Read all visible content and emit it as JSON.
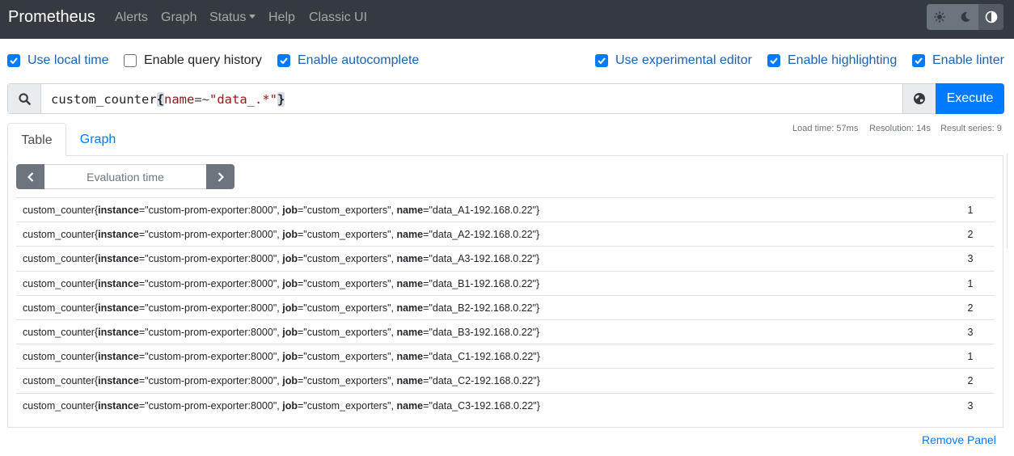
{
  "navbar": {
    "brand": "Prometheus",
    "links": [
      "Alerts",
      "Graph",
      "Status",
      "Help",
      "Classic UI"
    ],
    "theme_buttons": [
      "sun-icon",
      "moon-icon",
      "adjust-icon"
    ]
  },
  "options": {
    "use_local_time": {
      "label": "Use local time",
      "checked": true
    },
    "query_history": {
      "label": "Enable query history",
      "checked": false
    },
    "autocomplete": {
      "label": "Enable autocomplete",
      "checked": true
    },
    "experimental_editor": {
      "label": "Use experimental editor",
      "checked": true
    },
    "highlighting": {
      "label": "Enable highlighting",
      "checked": true
    },
    "linter": {
      "label": "Enable linter",
      "checked": true
    }
  },
  "query": {
    "metric": "custom_counter",
    "open_brace": "{",
    "label": "name",
    "operator": "=~",
    "value": "\"data_.*\"",
    "close_brace": "}",
    "execute_label": "Execute"
  },
  "tabs": {
    "table": "Table",
    "graph": "Graph"
  },
  "stats": {
    "load_time": "Load time: 57ms",
    "resolution": "Resolution: 14s",
    "result_series": "Result series: 9"
  },
  "eval_placeholder": "Evaluation time",
  "results": [
    {
      "metric": "custom_counter",
      "instance": "\"custom-prom-exporter:8000\"",
      "job": "\"custom_exporters\"",
      "name": "\"data_A1-192.168.0.22\"",
      "value": "1"
    },
    {
      "metric": "custom_counter",
      "instance": "\"custom-prom-exporter:8000\"",
      "job": "\"custom_exporters\"",
      "name": "\"data_A2-192.168.0.22\"",
      "value": "2"
    },
    {
      "metric": "custom_counter",
      "instance": "\"custom-prom-exporter:8000\"",
      "job": "\"custom_exporters\"",
      "name": "\"data_A3-192.168.0.22\"",
      "value": "3"
    },
    {
      "metric": "custom_counter",
      "instance": "\"custom-prom-exporter:8000\"",
      "job": "\"custom_exporters\"",
      "name": "\"data_B1-192.168.0.22\"",
      "value": "1"
    },
    {
      "metric": "custom_counter",
      "instance": "\"custom-prom-exporter:8000\"",
      "job": "\"custom_exporters\"",
      "name": "\"data_B2-192.168.0.22\"",
      "value": "2"
    },
    {
      "metric": "custom_counter",
      "instance": "\"custom-prom-exporter:8000\"",
      "job": "\"custom_exporters\"",
      "name": "\"data_B3-192.168.0.22\"",
      "value": "3"
    },
    {
      "metric": "custom_counter",
      "instance": "\"custom-prom-exporter:8000\"",
      "job": "\"custom_exporters\"",
      "name": "\"data_C1-192.168.0.22\"",
      "value": "1"
    },
    {
      "metric": "custom_counter",
      "instance": "\"custom-prom-exporter:8000\"",
      "job": "\"custom_exporters\"",
      "name": "\"data_C2-192.168.0.22\"",
      "value": "2"
    },
    {
      "metric": "custom_counter",
      "instance": "\"custom-prom-exporter:8000\"",
      "job": "\"custom_exporters\"",
      "name": "\"data_C3-192.168.0.22\"",
      "value": "3"
    }
  ],
  "label_keys": {
    "instance": "instance",
    "job": "job",
    "name": "name"
  },
  "remove_panel": "Remove Panel",
  "colors": {
    "navbar": "#343a40",
    "primary": "#007bff",
    "secondary": "#6c757d"
  }
}
